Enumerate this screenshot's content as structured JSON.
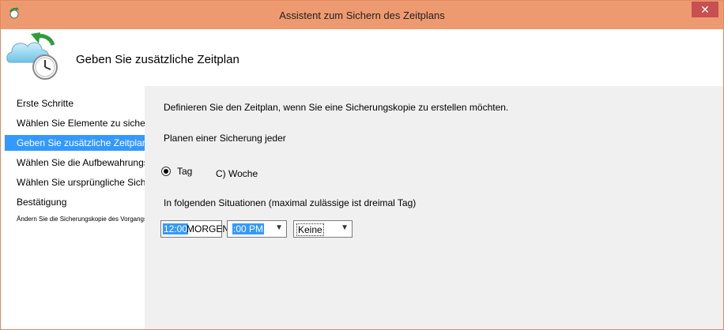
{
  "window": {
    "title": "Assistent zum Sichern des Zeitplans",
    "close_glyph": "✕",
    "accent": "#ee9a70"
  },
  "header": {
    "title": "Geben Sie zusätzliche Zeitplan",
    "icon": "backup-schedule-icon"
  },
  "nav": {
    "items": [
      {
        "label": "Erste Schritte"
      },
      {
        "label": "Wählen Sie Elemente zu sichern"
      },
      {
        "label": "Geben Sie zusätzliche Zeitplan"
      },
      {
        "label": "Wählen Sie die Aufbewahrungsrichtlinie"
      },
      {
        "label": "Wählen Sie ursprüngliche Sicherung Typ aus."
      },
      {
        "label": "Bestätigung"
      },
      {
        "label": "Ändern Sie die Sicherungskopie des Vorgangsfortschritts"
      }
    ],
    "active_index": 2,
    "active_color": "#3399ff"
  },
  "main": {
    "description": "Definieren Sie den Zeitplan, wenn Sie eine Sicherungskopie zu erstellen möchten.",
    "plan_label": "Planen einer Sicherung jeder",
    "radio_day": "Tag",
    "radio_week": "C) Woche",
    "situations_label": "In folgenden Situationen (maximal zulässige ist dreimal Tag)",
    "time1_hours": "12:00",
    "time1_ampm": "MORGENS",
    "time2": ":00 PM",
    "third_select": "Keine"
  }
}
